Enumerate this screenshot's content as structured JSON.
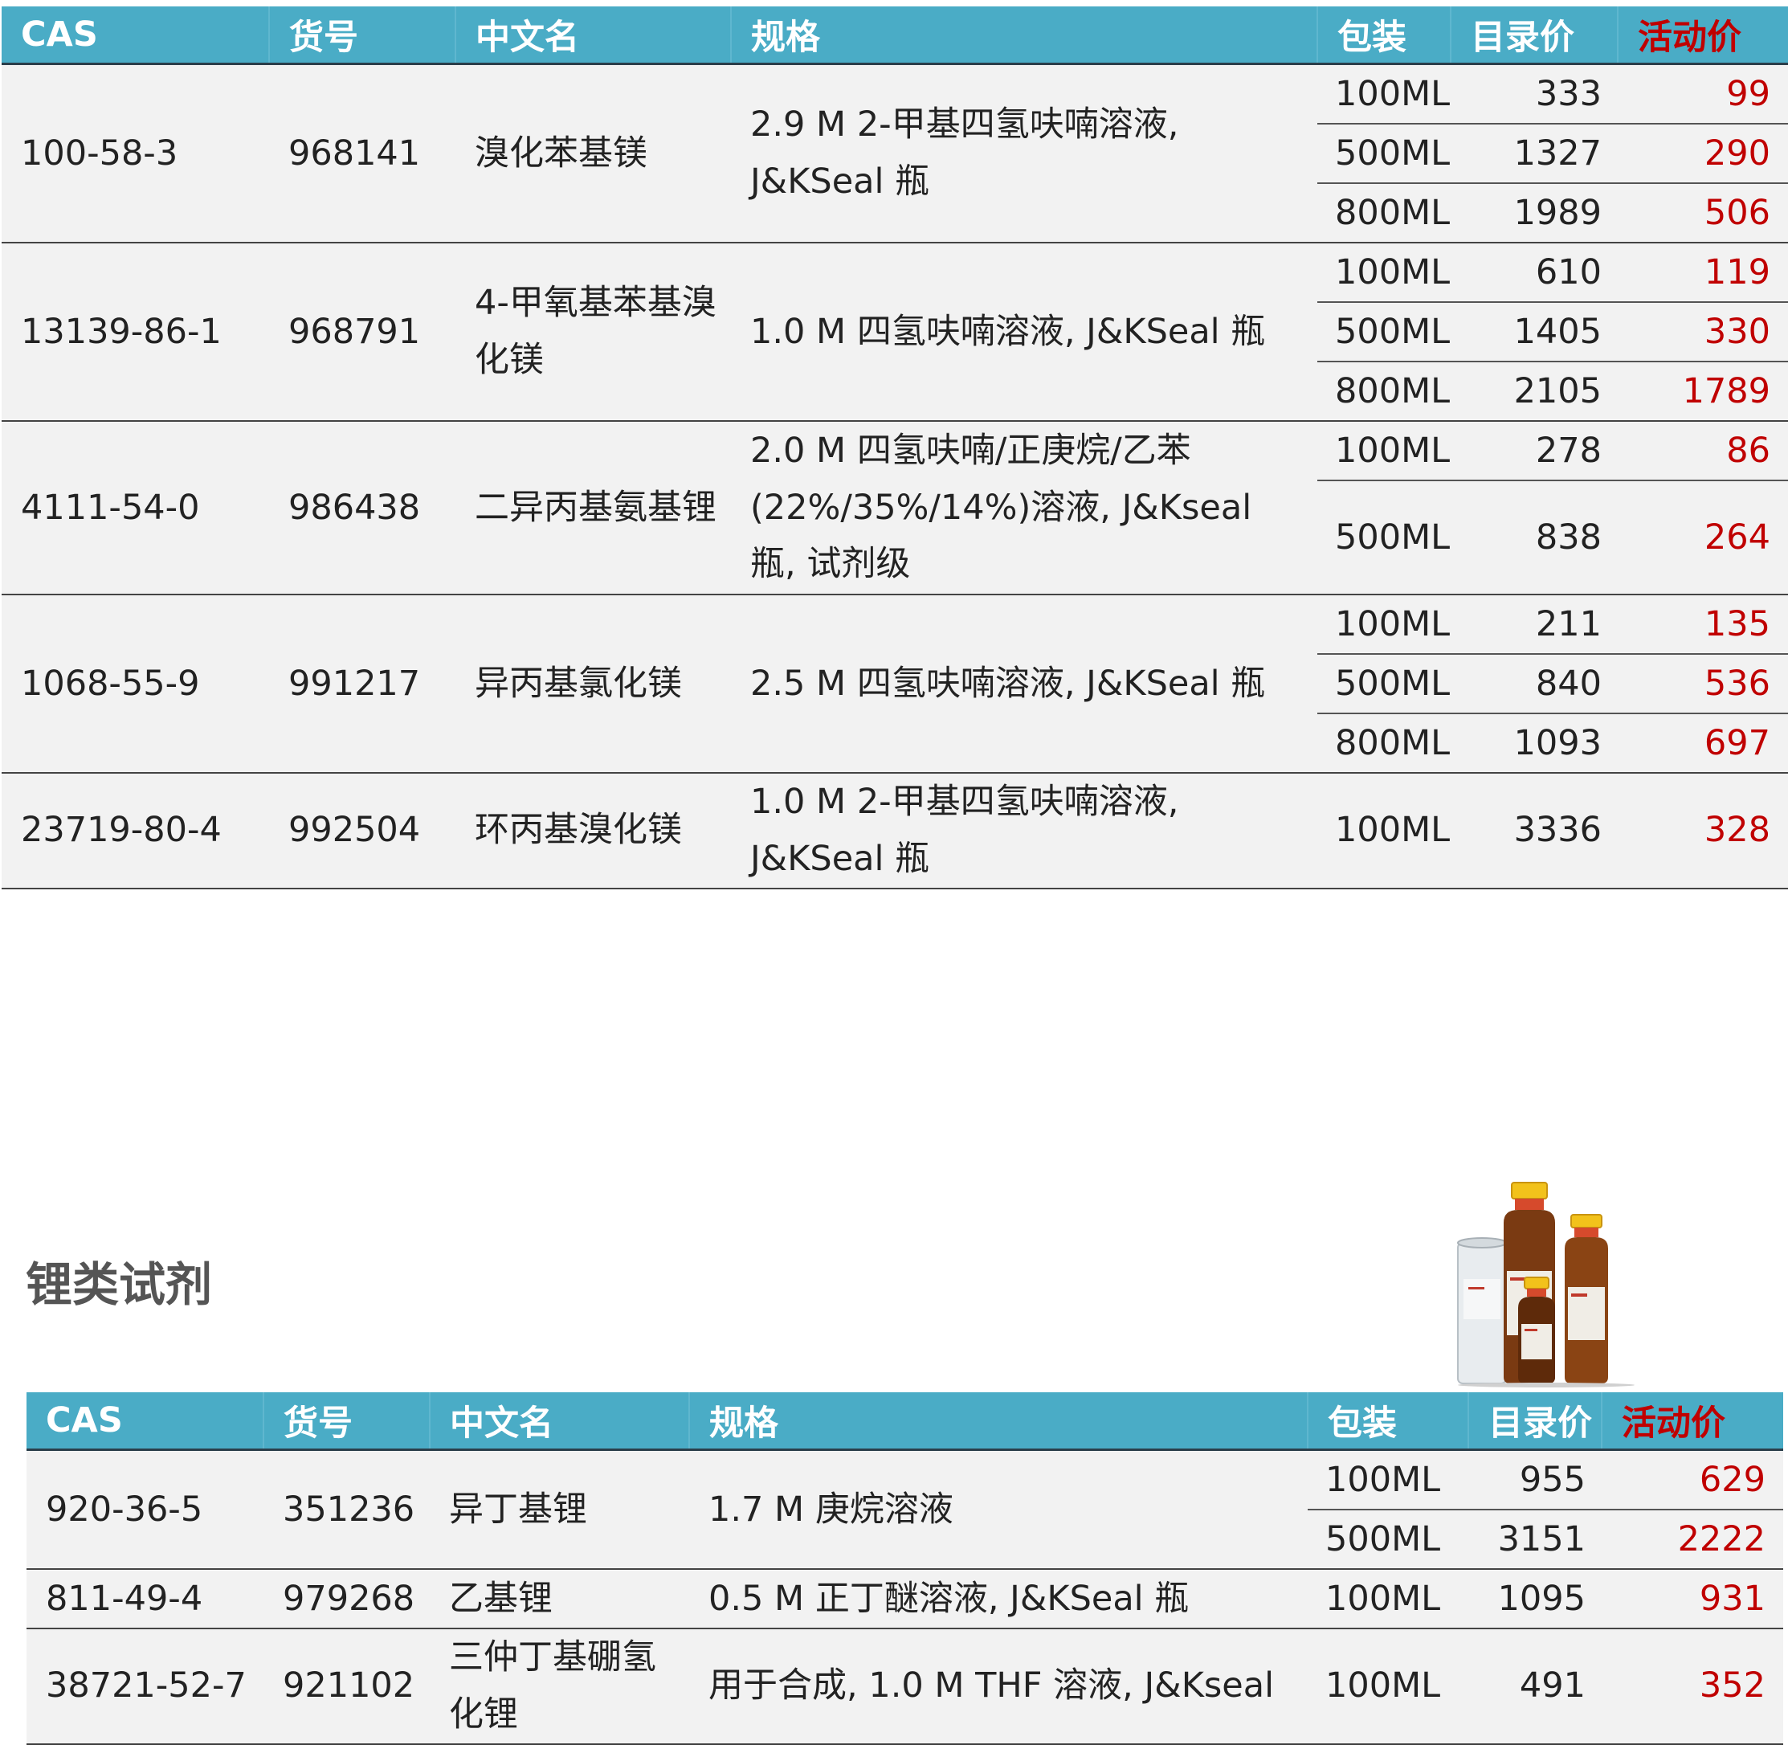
{
  "colors": {
    "header_bg": "#4aacc6",
    "header_text": "#ffffff",
    "promo": "#c00000",
    "row_bg": "#f2f2f2"
  },
  "headers": {
    "cas": "CAS",
    "item_no": "货号",
    "name": "中文名",
    "spec": "规格",
    "package": "包装",
    "list_price": "目录价",
    "promo_price": "活动价"
  },
  "table1": {
    "rows": [
      {
        "cas": "100-58-3",
        "item_no": "968141",
        "name": "溴化苯基镁",
        "spec": "2.9 M 2-甲基四氢呋喃溶液, J&KSeal 瓶",
        "packs": [
          {
            "size": "100ML",
            "list": "333",
            "promo": "99"
          },
          {
            "size": "500ML",
            "list": "1327",
            "promo": "290"
          },
          {
            "size": "800ML",
            "list": "1989",
            "promo": "506"
          }
        ]
      },
      {
        "cas": "13139-86-1",
        "item_no": "968791",
        "name": "4-甲氧基苯基溴化镁",
        "spec": "1.0 M 四氢呋喃溶液, J&KSeal 瓶",
        "packs": [
          {
            "size": "100ML",
            "list": "610",
            "promo": "119"
          },
          {
            "size": "500ML",
            "list": "1405",
            "promo": "330"
          },
          {
            "size": "800ML",
            "list": "2105",
            "promo": "1789"
          }
        ]
      },
      {
        "cas": "4111-54-0",
        "item_no": "986438",
        "name": "二异丙基氨基锂",
        "spec": "2.0 M 四氢呋喃/正庚烷/乙苯(22%/35%/14%)溶液, J&Kseal 瓶, 试剂级",
        "packs": [
          {
            "size": "100ML",
            "list": "278",
            "promo": "86"
          },
          {
            "size": "500ML",
            "list": "838",
            "promo": "264"
          }
        ]
      },
      {
        "cas": "1068-55-9",
        "item_no": "991217",
        "name": "异丙基氯化镁",
        "spec": "2.5 M 四氢呋喃溶液, J&KSeal 瓶",
        "packs": [
          {
            "size": "100ML",
            "list": "211",
            "promo": "135"
          },
          {
            "size": "500ML",
            "list": "840",
            "promo": "536"
          },
          {
            "size": "800ML",
            "list": "1093",
            "promo": "697"
          }
        ]
      },
      {
        "cas": "23719-80-4",
        "item_no": "992504",
        "name": "环丙基溴化镁",
        "spec": "1.0 M 2-甲基四氢呋喃溶液, J&KSeal 瓶",
        "packs": [
          {
            "size": "100ML",
            "list": "3336",
            "promo": "328"
          }
        ]
      }
    ]
  },
  "section": {
    "title": "锂类试剂",
    "image_alt": "reagent-bottles"
  },
  "table2": {
    "rows": [
      {
        "cas": "920-36-5",
        "item_no": "351236",
        "name": "异丁基锂",
        "spec": "1.7 M 庚烷溶液",
        "packs": [
          {
            "size": "100ML",
            "list": "955",
            "promo": "629"
          },
          {
            "size": "500ML",
            "list": "3151",
            "promo": "2222"
          }
        ]
      },
      {
        "cas": "811-49-4",
        "item_no": "979268",
        "name": "乙基锂",
        "spec": "0.5 M 正丁醚溶液, J&KSeal 瓶",
        "packs": [
          {
            "size": "100ML",
            "list": "1095",
            "promo": "931"
          }
        ]
      },
      {
        "cas": "38721-52-7",
        "item_no": "921102",
        "name": "三仲丁基硼氢化锂",
        "spec": "用于合成, 1.0 M THF 溶液, J&Kseal",
        "packs": [
          {
            "size": "100ML",
            "list": "491",
            "promo": "352"
          }
        ]
      }
    ]
  }
}
